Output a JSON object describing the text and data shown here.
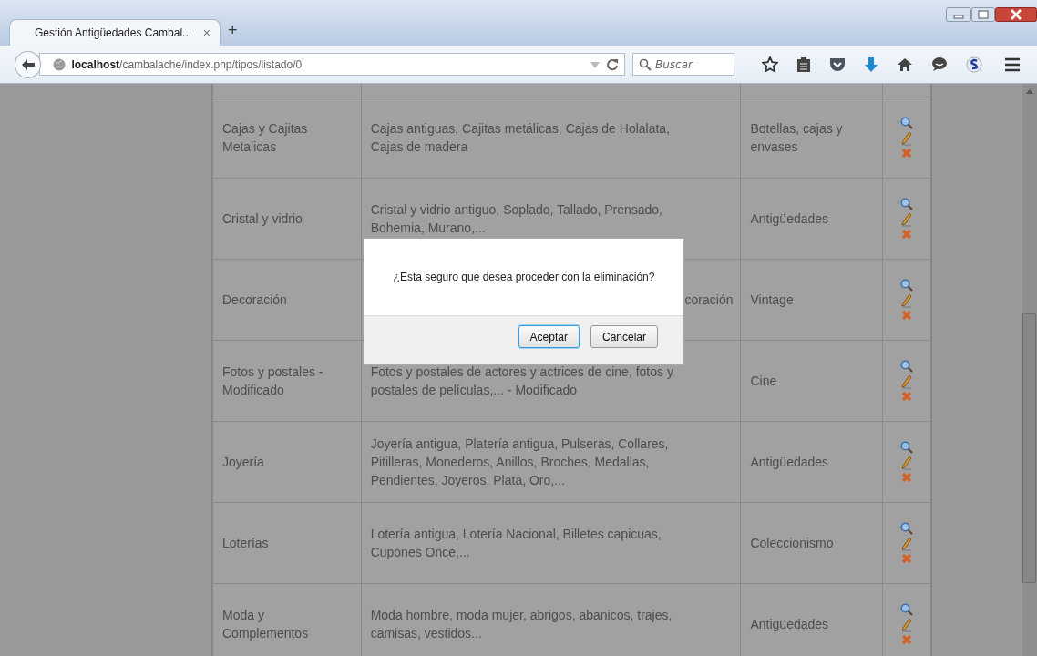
{
  "browser": {
    "tabs": [
      {
        "title": "Gestión Antigüedades Cambal...",
        "close": "×",
        "selected": true
      }
    ],
    "new_tab": "+",
    "url_host": "localhost",
    "url_path": "/cambalache/index.php/tipos/listado/0",
    "search": {
      "placeholder": "Buscar"
    }
  },
  "table": {
    "rows": [
      {
        "name": "",
        "description": "",
        "category": ""
      },
      {
        "name": "Cajas y Cajitas Metalicas",
        "description": "Cajas antiguas, Cajitas metálicas, Cajas de Holalata, Cajas de madera",
        "category": "Botellas, cajas y envases",
        "actions": true,
        "partially_hidden": false
      },
      {
        "name": "Cristal y vidrio",
        "description": "Cristal y vidrio antiguo, Soplado, Tallado, Prensado, Bohemia, Murano,...",
        "category": "Antigüedades",
        "actions": true,
        "partially_hidden": false
      },
      {
        "name": "Decoración",
        "description": "coración",
        "category": "Vintage",
        "actions": true,
        "partially_hidden": true
      },
      {
        "name": "Fotos y postales - Modificado",
        "description": "Fotos y postales de actores y actrices de cine, fotos y postales de películas,... - Modificado",
        "category": "Cine",
        "actions": true,
        "partially_hidden": false
      },
      {
        "name": "Joyería",
        "description": "Joyería antigua, Platería antigua, Pulseras, Collares, Pitilleras, Monederos, Anillos, Broches, Medallas, Pendientes, Joyeros, Plata, Oro,...",
        "category": "Antigüedades",
        "actions": true,
        "partially_hidden": false
      },
      {
        "name": "Loterías",
        "description": "Lotería antigua, Lotería Nacional, Billetes capicuas, Cupones Once,...",
        "category": "Coleccionismo",
        "actions": true,
        "partially_hidden": false
      },
      {
        "name": "Moda y Complementos",
        "description": "Moda hombre, moda mujer, abrigos, abanicos, trajes, camisas, vestidos...",
        "category": "Antigüedades",
        "actions": true,
        "partially_hidden": false
      }
    ]
  },
  "dialog": {
    "message": "¿Esta seguro que desea proceder con la eliminación?",
    "buttons": [
      {
        "label": "Aceptar",
        "focused": true
      },
      {
        "label": "Cancelar",
        "focused": false
      }
    ]
  }
}
